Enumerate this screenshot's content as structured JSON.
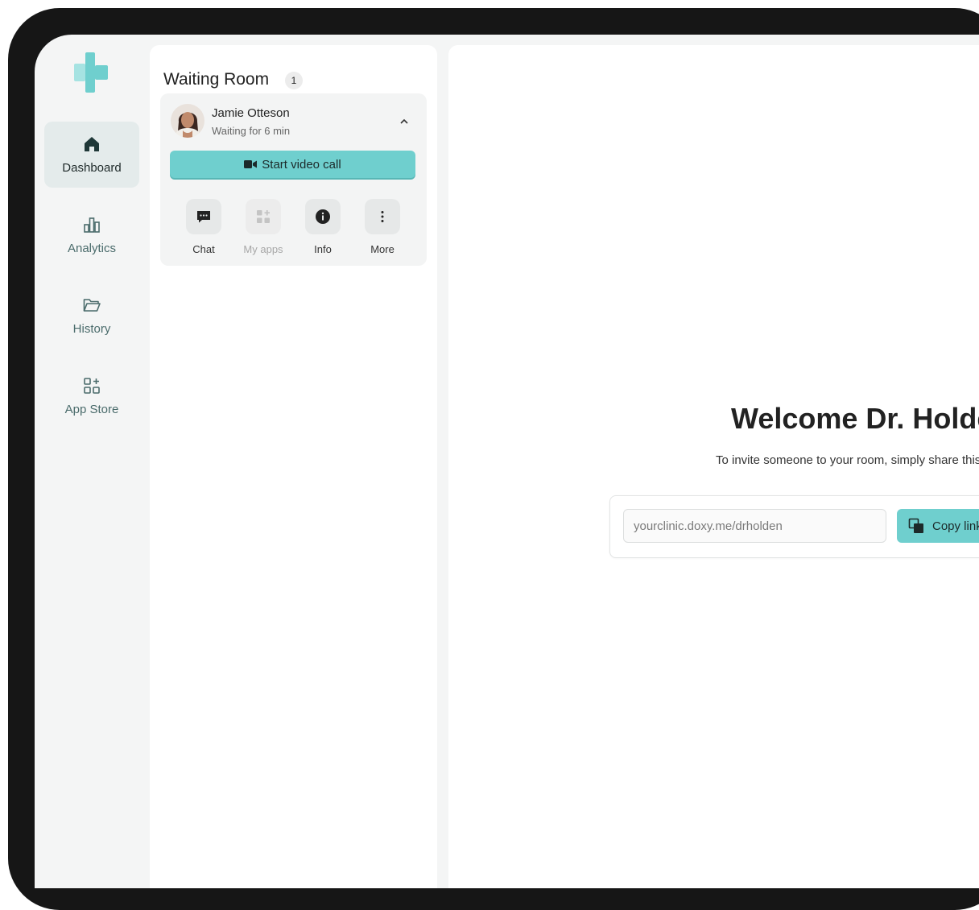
{
  "sidebar": {
    "items": [
      {
        "label": "Dashboard",
        "icon": "home-icon",
        "active": true
      },
      {
        "label": "Analytics",
        "icon": "bar-chart-icon",
        "active": false
      },
      {
        "label": "History",
        "icon": "folder-icon",
        "active": false
      },
      {
        "label": "App Store",
        "icon": "apps-grid-icon",
        "active": false
      }
    ]
  },
  "waiting_room": {
    "title": "Waiting Room",
    "count": "1",
    "patient": {
      "name": "Jamie Otteson",
      "status": "Waiting for 6 min"
    },
    "start_call_label": "Start video call",
    "actions": [
      {
        "label": "Chat",
        "icon": "chat-icon",
        "enabled": true
      },
      {
        "label": "My apps",
        "icon": "apps-icon",
        "enabled": false
      },
      {
        "label": "Info",
        "icon": "info-icon",
        "enabled": true
      },
      {
        "label": "More",
        "icon": "more-vertical-icon",
        "enabled": true
      }
    ]
  },
  "main": {
    "welcome": "Welcome Dr. Holden",
    "invite_text": "To invite someone to your room, simply share this link",
    "link_placeholder": "yourclinic.doxy.me/drholden",
    "copy_label": "Copy link"
  },
  "colors": {
    "accent": "#6fcfce",
    "device_frame": "#161616",
    "nav_active_bg": "#e4ebeb"
  }
}
